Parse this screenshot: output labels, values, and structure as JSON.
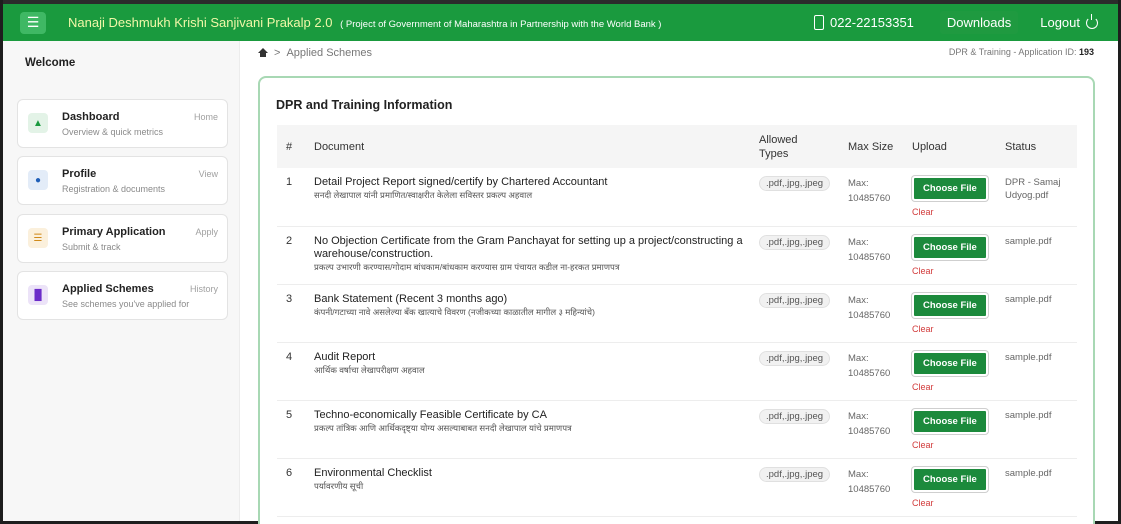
{
  "header": {
    "title": "Nanaji Deshmukh Krishi Sanjivani Prakalp 2.0",
    "subtitle": "( Project of Government of Maharashtra in Partnership with the World Bank )",
    "phone": "022-22153351",
    "downloads_label": "Downloads",
    "logout_label": "Logout"
  },
  "sidebar": {
    "welcome": "Welcome",
    "items": [
      {
        "title": "Dashboard",
        "sub": "Overview & quick metrics",
        "tag": "Home",
        "color": "#1a9a3e",
        "bg": "#e3f3e7",
        "icon": "home-icon"
      },
      {
        "title": "Profile",
        "sub": "Registration & documents",
        "tag": "View",
        "color": "#1f5fb8",
        "bg": "#e3ecf8",
        "icon": "user-icon"
      },
      {
        "title": "Primary Application",
        "sub": "Submit & track",
        "tag": "Apply",
        "color": "#d08a1a",
        "bg": "#fbf0dc",
        "icon": "list-icon"
      },
      {
        "title": "Applied Schemes",
        "sub": "See schemes you've applied for",
        "tag": "History",
        "color": "#6b2bc9",
        "bg": "#ece3f8",
        "icon": "bookmark-icon"
      }
    ]
  },
  "breadcrumb": {
    "current": "Applied Schemes"
  },
  "application": {
    "label": "DPR & Training - Application ID:",
    "id": "193"
  },
  "card": {
    "title": "DPR and Training Information",
    "columns": {
      "num": "#",
      "document": "Document",
      "types": "Allowed Types",
      "max": "Max Size",
      "upload": "Upload",
      "status": "Status"
    },
    "rows": [
      {
        "num": "1",
        "doc": "Detail Project Report signed/certify by Chartered Accountant",
        "doc_mr": "सनदी लेखापाल यांनी प्रमाणित/स्वाक्षरीत केलेला सविस्तर प्रकल्प अहवाल",
        "types": ".pdf,.jpg,.jpeg",
        "max_label": "Max:",
        "max_value": "10485760",
        "button": "Choose File",
        "clear": "Clear",
        "status": "DPR - Samaj Udyog.pdf"
      },
      {
        "num": "2",
        "doc": "No Objection Certificate from the Gram Panchayat for setting up a project/constructing a warehouse/construction.",
        "doc_mr": "प्रकल्प उभारणी करण्यास/गोदाम बांधकाम/बांधकाम करण्यास ग्राम पंचायत कडील ना-हरकत प्रमाणपत्र",
        "types": ".pdf,.jpg,.jpeg",
        "max_label": "Max:",
        "max_value": "10485760",
        "button": "Choose File",
        "clear": "Clear",
        "status": "sample.pdf"
      },
      {
        "num": "3",
        "doc": "Bank Statement (Recent 3 months ago)",
        "doc_mr": "कंपनी/गटाच्या नावे असलेल्या बँक खात्याचे विवरण (नजीकच्या काळातील मागील ३ महिन्यांचे)",
        "types": ".pdf,.jpg,.jpeg",
        "max_label": "Max:",
        "max_value": "10485760",
        "button": "Choose File",
        "clear": "Clear",
        "status": "sample.pdf"
      },
      {
        "num": "4",
        "doc": "Audit Report",
        "doc_mr": "आर्थिक वर्षाचा लेखापरीक्षण अहवाल",
        "types": ".pdf,.jpg,.jpeg",
        "max_label": "Max:",
        "max_value": "10485760",
        "button": "Choose File",
        "clear": "Clear",
        "status": "sample.pdf"
      },
      {
        "num": "5",
        "doc": "Techno-economically Feasible Certificate by CA",
        "doc_mr": "प्रकल्प तांत्रिक आणि आर्थिकदृष्ट्या योग्य असल्याबाबत सनदी लेखापाल यांचे प्रमाणपत्र",
        "types": ".pdf,.jpg,.jpeg",
        "max_label": "Max:",
        "max_value": "10485760",
        "button": "Choose File",
        "clear": "Clear",
        "status": "sample.pdf"
      },
      {
        "num": "6",
        "doc": "Environmental Checklist",
        "doc_mr": "पर्यावरणीय सूची",
        "types": ".pdf,.jpg,.jpeg",
        "max_label": "Max:",
        "max_value": "10485760",
        "button": "Choose File",
        "clear": "Clear",
        "status": "sample.pdf"
      }
    ]
  }
}
